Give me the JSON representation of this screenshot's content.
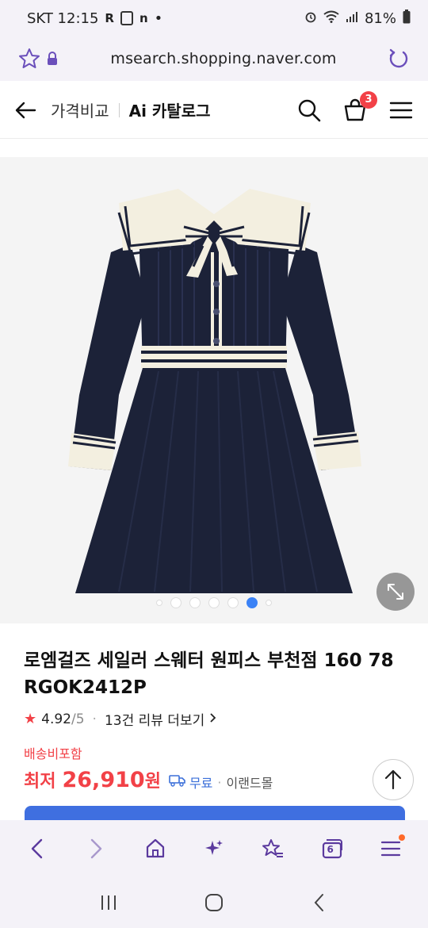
{
  "status_bar": {
    "carrier_time": "SKT 12:15",
    "left_glyphs": [
      "R",
      "n",
      "•"
    ],
    "battery": "81%"
  },
  "url_bar": {
    "url": "msearch.shopping.naver.com"
  },
  "header": {
    "crumb_1": "가격비교",
    "crumb_2": "Ai 카탈로그",
    "cart_count": "3"
  },
  "carousel": {
    "total_dots": 7,
    "active_index": 5
  },
  "product": {
    "title": "로엠걸즈 세일러 스웨터 원피스 부천점 160 78 RGOK2412P",
    "rating": "4.92",
    "rating_max": "/5",
    "review_text": "13건 리뷰 더보기",
    "shipping_label": "배송비포함",
    "price_prefix": "최저",
    "price": "26,910",
    "price_unit": "원",
    "delivery": "무료",
    "mall": "이랜드몰"
  },
  "colors": {
    "accent_red": "#f24147",
    "accent_blue": "#3b82f6",
    "browser_purple": "#5b3a9e",
    "dress_navy": "#1c2238",
    "dress_cream": "#f3efe0"
  },
  "icons": {
    "browser_nav": [
      "back-icon",
      "forward-icon",
      "home-icon",
      "ai-sparkle-icon",
      "bookmark-star-icon",
      "tabs-icon",
      "menu-icon"
    ],
    "system_nav": [
      "recents-icon",
      "home-circle-icon",
      "system-back-icon"
    ]
  },
  "browser_tabs_count": "6"
}
